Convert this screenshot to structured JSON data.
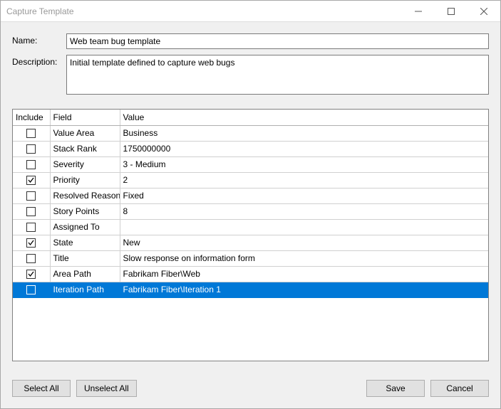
{
  "window": {
    "title": "Capture Template"
  },
  "form": {
    "name_label": "Name:",
    "name_value": "Web team bug template",
    "desc_label": "Description:",
    "desc_value": "Initial template defined to capture web bugs"
  },
  "grid": {
    "headers": {
      "include": "Include",
      "field": "Field",
      "value": "Value"
    },
    "rows": [
      {
        "include": false,
        "field": "Value Area",
        "value": "Business",
        "selected": false
      },
      {
        "include": false,
        "field": "Stack Rank",
        "value": "1750000000",
        "selected": false
      },
      {
        "include": false,
        "field": "Severity",
        "value": "3 - Medium",
        "selected": false
      },
      {
        "include": true,
        "field": "Priority",
        "value": "2",
        "selected": false
      },
      {
        "include": false,
        "field": "Resolved Reason",
        "value": "Fixed",
        "selected": false
      },
      {
        "include": false,
        "field": "Story Points",
        "value": "8",
        "selected": false
      },
      {
        "include": false,
        "field": "Assigned To",
        "value": "",
        "selected": false
      },
      {
        "include": true,
        "field": "State",
        "value": "New",
        "selected": false
      },
      {
        "include": false,
        "field": "Title",
        "value": "Slow response on information form",
        "selected": false
      },
      {
        "include": true,
        "field": "Area Path",
        "value": "Fabrikam Fiber\\Web",
        "selected": false
      },
      {
        "include": false,
        "field": "Iteration Path",
        "value": "Fabrikam Fiber\\Iteration 1",
        "selected": true
      }
    ]
  },
  "buttons": {
    "select_all": "Select All",
    "unselect_all": "Unselect All",
    "save": "Save",
    "cancel": "Cancel"
  }
}
